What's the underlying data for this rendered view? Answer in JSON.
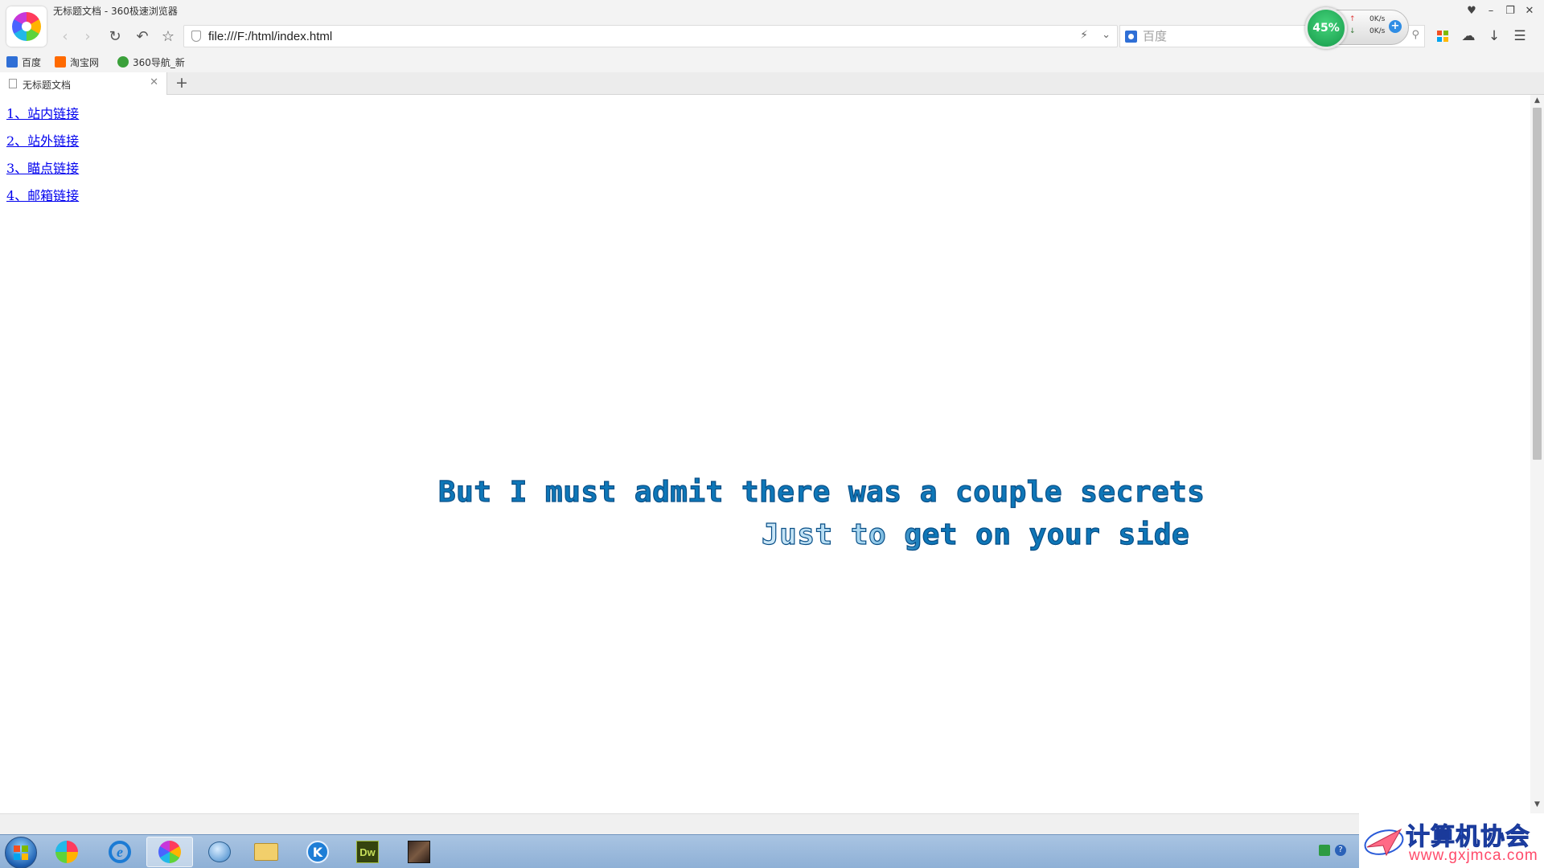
{
  "window": {
    "title": "无标题文档 - 360极速浏览器",
    "controls": [
      "minimize",
      "maximize",
      "close"
    ]
  },
  "toolbar": {
    "address_url": "file:///F:/html/index.html",
    "search_placeholder": "百度"
  },
  "net_monitor": {
    "percent": "45%",
    "up_speed": "0K/s",
    "down_speed": "0K/s"
  },
  "bookmarks": [
    {
      "label": "百度",
      "icon": "baidu-icon"
    },
    {
      "label": "淘宝网",
      "icon": "taobao-icon"
    },
    {
      "label": "360导航_新",
      "icon": "nav360-icon"
    }
  ],
  "tabs": [
    {
      "label": "无标题文档",
      "active": true
    }
  ],
  "page": {
    "links": [
      {
        "label": "1、站内链接"
      },
      {
        "label": "2、站外链接"
      },
      {
        "label": "3、瞄点链接"
      },
      {
        "label": "4、邮箱链接"
      }
    ],
    "lyrics": [
      "But I must admit there was a couple secrets",
      "Just to get on your side"
    ],
    "colors": {
      "link": "#0000ee",
      "lyric": "#0e77b8",
      "lyric_outline": "#0a4f87"
    }
  },
  "taskbar": {
    "items": [
      {
        "name": "pinwheel-app",
        "active": false
      },
      {
        "name": "internet-explorer",
        "active": false
      },
      {
        "name": "browser-360",
        "active": true
      },
      {
        "name": "chat-app",
        "active": false
      },
      {
        "name": "file-explorer",
        "active": false
      },
      {
        "name": "k-app",
        "active": false
      },
      {
        "name": "dreamweaver",
        "active": false,
        "label": "Dw"
      },
      {
        "name": "photo-app",
        "active": false
      }
    ]
  },
  "watermark": {
    "title": "计算机协会",
    "url": "www.gxjmca.com"
  }
}
